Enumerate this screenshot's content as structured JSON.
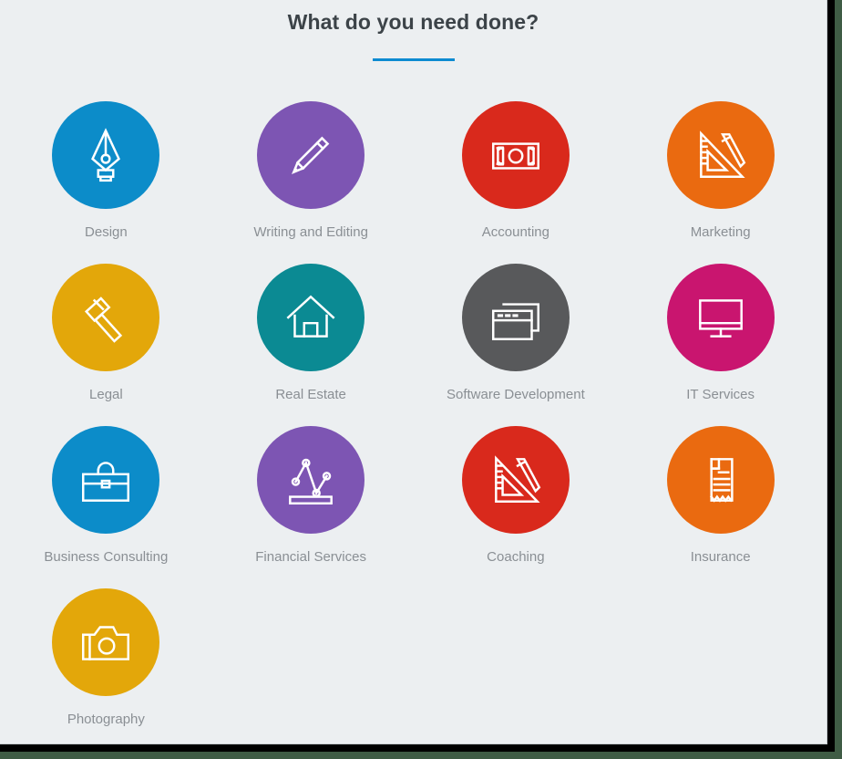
{
  "header": {
    "title": "What do you need done?",
    "accent_color": "#0d8bd1"
  },
  "page": {
    "background_color": "#eceff1",
    "label_color": "#8a8f94",
    "title_color": "#3c4348",
    "frame_color": "#000000",
    "outer_color": "#3f5c45"
  },
  "categories": [
    {
      "label": "Design",
      "icon": "pen-nib-icon",
      "color": "#0c8cc9"
    },
    {
      "label": "Writing and Editing",
      "icon": "pencil-icon",
      "color": "#7d55b3"
    },
    {
      "label": "Accounting",
      "icon": "banknote-icon",
      "color": "#d9291c"
    },
    {
      "label": "Marketing",
      "icon": "ruler-pencil-icon",
      "color": "#ea6a10"
    },
    {
      "label": "Legal",
      "icon": "gavel-icon",
      "color": "#e3a70a"
    },
    {
      "label": "Real Estate",
      "icon": "house-icon",
      "color": "#0b8a93"
    },
    {
      "label": "Software Development",
      "icon": "browser-windows-icon",
      "color": "#58595b"
    },
    {
      "label": "IT Services",
      "icon": "monitor-icon",
      "color": "#c9156f"
    },
    {
      "label": "Business Consulting",
      "icon": "briefcase-icon",
      "color": "#0c8cc9"
    },
    {
      "label": "Financial Services",
      "icon": "line-chart-icon",
      "color": "#7d55b3"
    },
    {
      "label": "Coaching",
      "icon": "ruler-pencil-icon",
      "color": "#d9291c"
    },
    {
      "label": "Insurance",
      "icon": "receipt-icon",
      "color": "#ea6a10"
    },
    {
      "label": "Photography",
      "icon": "camera-icon",
      "color": "#e3a70a"
    }
  ]
}
